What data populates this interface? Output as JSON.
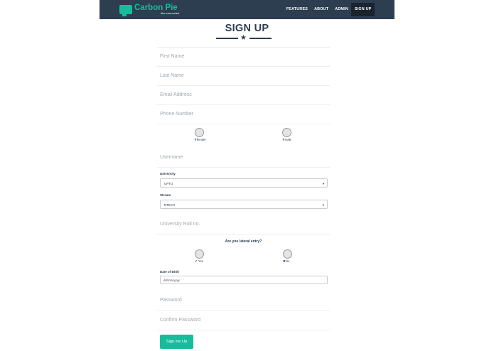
{
  "navbar": {
    "brand_name": "Carbon Pie",
    "brand_tagline": "#be connected",
    "links": [
      "FEATURES",
      "ABOUT",
      "ADMIN",
      "SIGN UP"
    ]
  },
  "page": {
    "title": "SIGN UP"
  },
  "form": {
    "first_name_placeholder": "First Name",
    "last_name_placeholder": "Last Name",
    "email_placeholder": "Email Address",
    "phone_placeholder": "Phone Number",
    "gender": {
      "female_label": "female",
      "male_label": "male"
    },
    "username_placeholder": "Username",
    "university": {
      "label": "University",
      "selected": "UPTU"
    },
    "stream": {
      "label": "Stream",
      "selected": "BTECH"
    },
    "roll_placeholder": "University Roll no.",
    "lateral": {
      "question": "Are you lateral entry?",
      "yes_label": "Yes",
      "no_label": "No"
    },
    "dob": {
      "label": "Date of Birth",
      "placeholder": "dd/mm/yyyy"
    },
    "password_placeholder": "Password",
    "confirm_password_placeholder": "Confirm Password",
    "submit_label": "Sign me Up"
  },
  "colors": {
    "navbar": "#2c3e50",
    "accent": "#18bc9c",
    "text": "#2c3e50"
  }
}
